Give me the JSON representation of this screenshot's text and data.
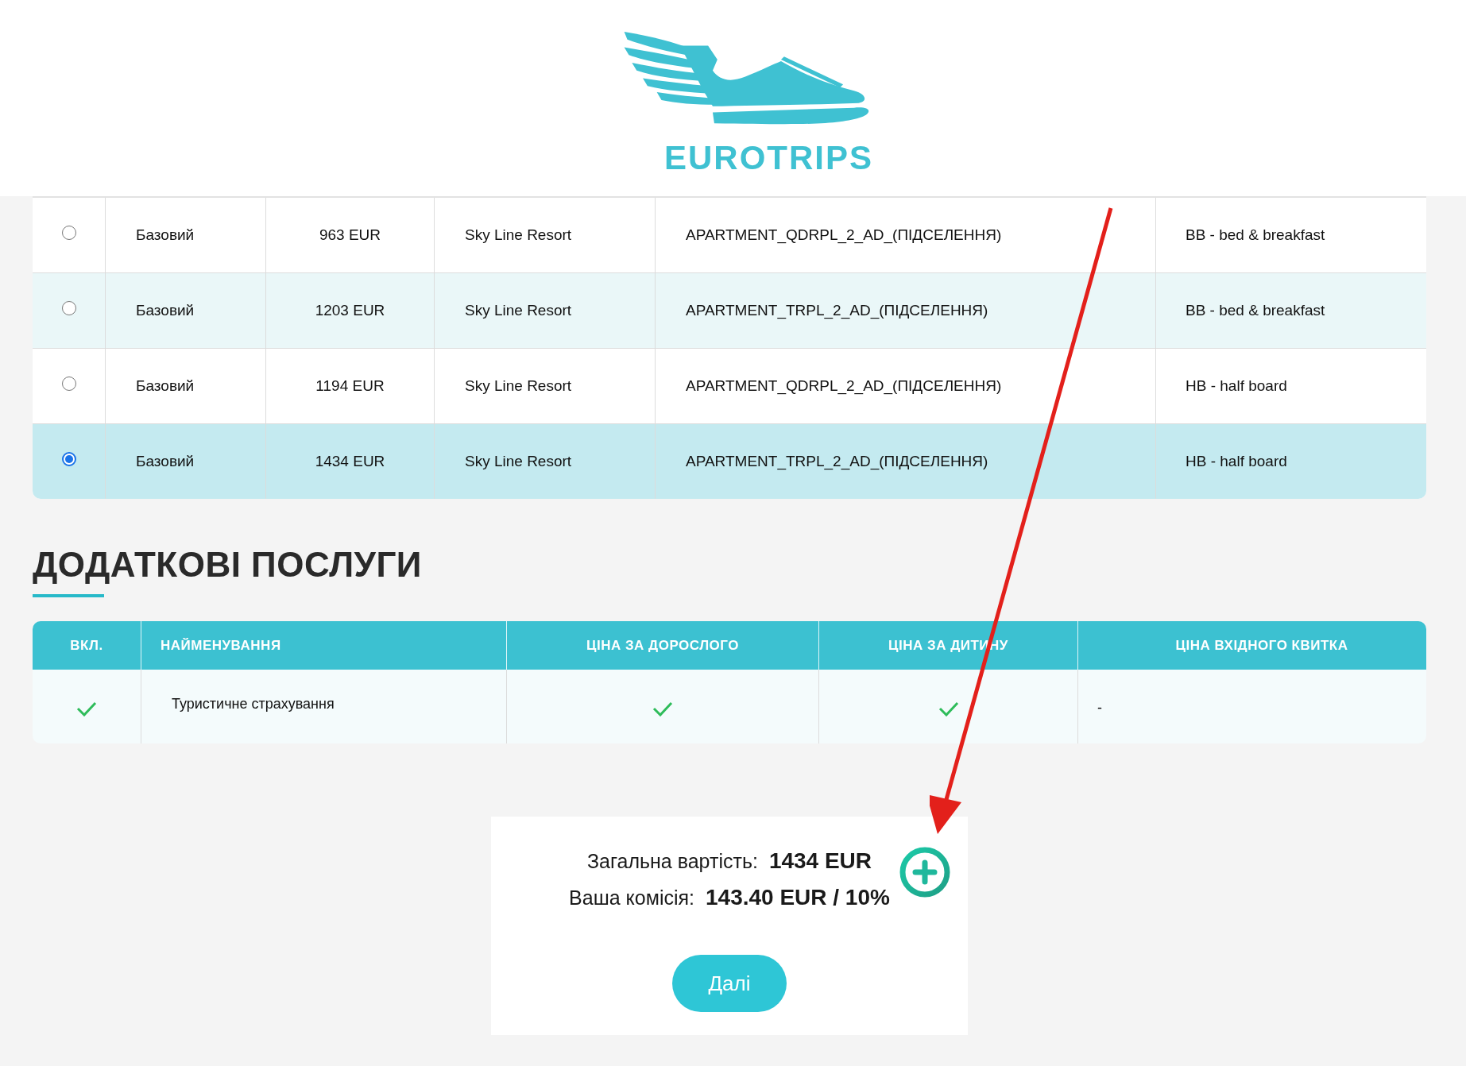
{
  "logo": {
    "text": "EUROTRIPS"
  },
  "rooms": [
    {
      "selected": false,
      "tariff": "Базовий",
      "price": "963 EUR",
      "hotel": "Sky Line Resort",
      "room": "APARTMENT_QDRPL_2_AD_(ПІДСЕЛЕННЯ)",
      "meal": "BB - bed & breakfast"
    },
    {
      "selected": false,
      "tariff": "Базовий",
      "price": "1203 EUR",
      "hotel": "Sky Line Resort",
      "room": "APARTMENT_TRPL_2_AD_(ПІДСЕЛЕННЯ)",
      "meal": "BB - bed & breakfast"
    },
    {
      "selected": false,
      "tariff": "Базовий",
      "price": "1194 EUR",
      "hotel": "Sky Line Resort",
      "room": "APARTMENT_QDRPL_2_AD_(ПІДСЕЛЕННЯ)",
      "meal": "HB - half board"
    },
    {
      "selected": true,
      "tariff": "Базовий",
      "price": "1434 EUR",
      "hotel": "Sky Line Resort",
      "room": "APARTMENT_TRPL_2_AD_(ПІДСЕЛЕННЯ)",
      "meal": "HB - half board"
    }
  ],
  "services": {
    "heading": "ДОДАТКОВІ ПОСЛУГИ",
    "columns": [
      "ВКЛ.",
      "НАЙМЕНУВАННЯ",
      "ЦІНА ЗА ДОРОСЛОГО",
      "ЦІНА ЗА ДИТИНУ",
      "ЦІНА ВХІДНОГО КВИТКА"
    ],
    "rows": [
      {
        "cells": [
          {
            "kind": "check"
          },
          {
            "kind": "text",
            "text": "Туристичне страхування"
          },
          {
            "kind": "check"
          },
          {
            "kind": "check"
          },
          {
            "kind": "text",
            "text": "-"
          }
        ]
      }
    ]
  },
  "summary": {
    "total_label": "Загальна вартість:",
    "total_value": "1434 EUR",
    "commission_label": "Ваша комісія:",
    "commission_value": "143.40 EUR / 10%",
    "next_button": "Далі"
  }
}
